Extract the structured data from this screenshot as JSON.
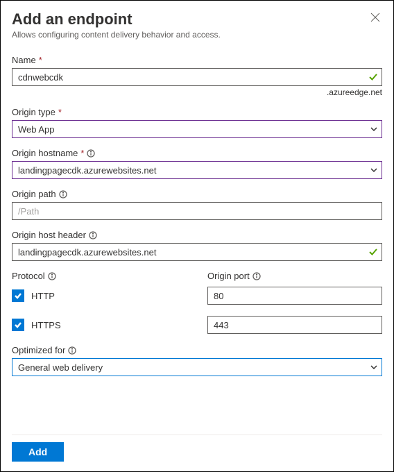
{
  "header": {
    "title": "Add an endpoint",
    "subtitle": "Allows configuring content delivery behavior and access."
  },
  "name": {
    "label": "Name",
    "value": "cdnwebcdk",
    "suffix": ".azureedge.net"
  },
  "originType": {
    "label": "Origin type",
    "value": "Web App"
  },
  "originHostname": {
    "label": "Origin hostname",
    "value": "landingpagecdk.azurewebsites.net"
  },
  "originPath": {
    "label": "Origin path",
    "placeholder": "/Path"
  },
  "originHostHeader": {
    "label": "Origin host header",
    "value": "landingpagecdk.azurewebsites.net"
  },
  "protocol": {
    "label": "Protocol",
    "http": "HTTP",
    "https": "HTTPS"
  },
  "originPort": {
    "label": "Origin port",
    "httpValue": "80",
    "httpsValue": "443"
  },
  "optimizedFor": {
    "label": "Optimized for",
    "value": "General web delivery"
  },
  "footer": {
    "addLabel": "Add"
  }
}
